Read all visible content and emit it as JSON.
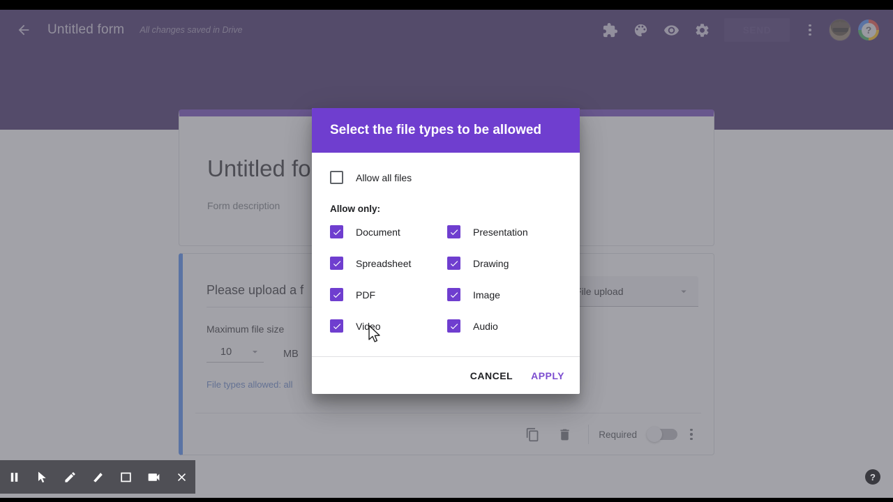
{
  "topbar": {
    "back_icon": "back-arrow-icon",
    "title": "Untitled form",
    "save_status": "All changes saved in Drive",
    "icons": [
      {
        "name": "addon-puzzle-icon",
        "glyph": "puzzle"
      },
      {
        "name": "palette-icon",
        "glyph": "palette"
      },
      {
        "name": "preview-eye-icon",
        "glyph": "eye"
      },
      {
        "name": "settings-gear-icon",
        "glyph": "gear"
      }
    ],
    "send_label": "SEND",
    "more_icon": "more-vertical-icon",
    "avatar_name": "user-avatar",
    "help_label": "?"
  },
  "form": {
    "title": "Untitled form",
    "description": "Form description",
    "question": {
      "title": "Please upload a f",
      "type_label": "File upload",
      "max_size_label": "Maximum file size",
      "max_size_value": "10",
      "max_size_unit": "MB",
      "file_types_link": "File types allowed: all",
      "required_label": "Required",
      "duplicate_icon": "duplicate-icon",
      "delete_icon": "trash-icon",
      "more_icon": "more-vertical-icon"
    }
  },
  "dialog": {
    "title": "Select the file types to be allowed",
    "allow_all": {
      "label": "Allow all files",
      "checked": false
    },
    "allow_only_label": "Allow only:",
    "file_types": [
      {
        "label": "Document",
        "checked": true
      },
      {
        "label": "Presentation",
        "checked": true
      },
      {
        "label": "Spreadsheet",
        "checked": true
      },
      {
        "label": "Drawing",
        "checked": true
      },
      {
        "label": "PDF",
        "checked": true
      },
      {
        "label": "Image",
        "checked": true
      },
      {
        "label": "Video",
        "checked": true
      },
      {
        "label": "Audio",
        "checked": true
      }
    ],
    "cancel_label": "CANCEL",
    "apply_label": "APPLY"
  },
  "recorder": {
    "buttons": [
      {
        "name": "pause-icon"
      },
      {
        "name": "cursor-arrow-icon"
      },
      {
        "name": "pencil-icon"
      },
      {
        "name": "highlighter-icon"
      },
      {
        "name": "square-icon"
      },
      {
        "name": "camcorder-icon"
      },
      {
        "name": "close-icon"
      }
    ],
    "help_label": "?"
  },
  "colors": {
    "header_purple": "#341b5e",
    "dialog_purple": "#6f3ecf",
    "checkbox_purple": "#6f3ecf",
    "apply_purple": "#7c4dd0",
    "question_accent": "#4285f4",
    "link_blue": "#5b7fc7"
  }
}
